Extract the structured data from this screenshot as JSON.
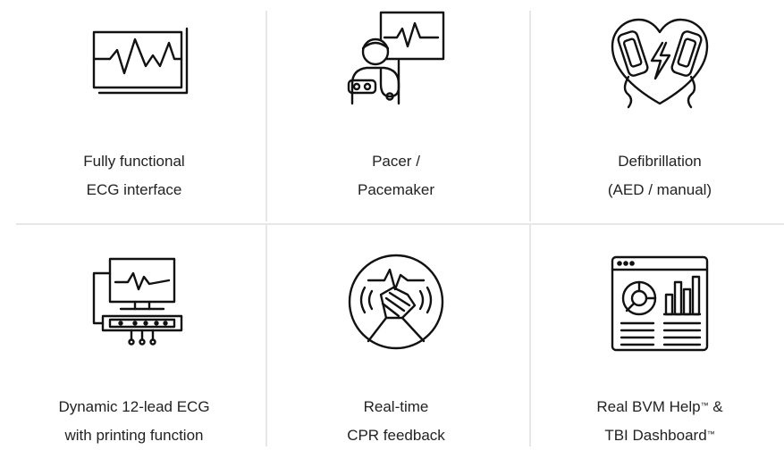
{
  "features": [
    {
      "line1": "Fully functional",
      "line2": "ECG interface",
      "icon": "ecg-monitor-icon"
    },
    {
      "line1": "Pacer /",
      "line2": "Pacemaker",
      "icon": "pacer-doctor-icon"
    },
    {
      "line1": "Defibrillation",
      "line2": "(AED / manual)",
      "icon": "defibrillator-heart-icon"
    },
    {
      "line1": "Dynamic 12-lead ECG",
      "line2": "with printing function",
      "icon": "ecg-printer-icon"
    },
    {
      "line1": "Real-time",
      "line2": "CPR feedback",
      "icon": "cpr-hands-icon"
    },
    {
      "line1": "Real BVM Help",
      "line1_tm": "™",
      "line1_suffix": " &",
      "line2": "TBI Dashboard",
      "line2_tm": "™",
      "icon": "dashboard-charts-icon"
    }
  ],
  "colors": {
    "text": "#222222",
    "icon_stroke": "#111111",
    "divider": "#e7e7e7"
  }
}
